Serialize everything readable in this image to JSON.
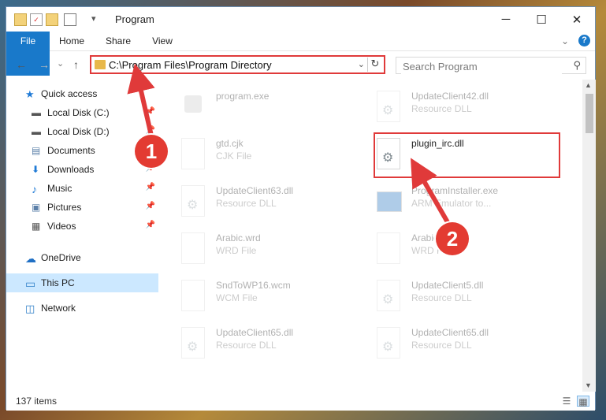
{
  "window": {
    "title": "Program",
    "minimize_glyph": "─",
    "maximize_glyph": "☐",
    "close_glyph": "✕"
  },
  "ribbon": {
    "tabs": [
      "File",
      "Home",
      "Share",
      "View"
    ],
    "expand_glyph": "⌄",
    "help_glyph": "?"
  },
  "address": {
    "back_glyph": "←",
    "forward_glyph": "→",
    "recent_glyph": "⌄",
    "up_glyph": "↑",
    "path": "C:\\Program Files\\Program Directory",
    "dropdown_glyph": "⌄",
    "refresh_glyph": "↻"
  },
  "search": {
    "placeholder": "Search Program",
    "icon": "search-icon",
    "glyph": "⚲"
  },
  "nav": {
    "pin_glyph": "📌",
    "items": [
      {
        "label": "Quick access",
        "icon": "star-icon",
        "glyph": "★",
        "color": "#1f7ad6"
      },
      {
        "label": "Local Disk (C:)",
        "icon": "disk-icon",
        "glyph": "▬",
        "color": "#555"
      },
      {
        "label": "Local Disk (D:)",
        "icon": "disk-icon",
        "glyph": "▬",
        "color": "#555"
      },
      {
        "label": "Documents",
        "icon": "document-icon",
        "glyph": "▤",
        "color": "#5a7fa8"
      },
      {
        "label": "Downloads",
        "icon": "download-icon",
        "glyph": "⬇",
        "color": "#1f7ad6"
      },
      {
        "label": "Music",
        "icon": "music-icon",
        "glyph": "♪",
        "color": "#1f7ad6"
      },
      {
        "label": "Pictures",
        "icon": "pictures-icon",
        "glyph": "▣",
        "color": "#5a7fa8"
      },
      {
        "label": "Videos",
        "icon": "videos-icon",
        "glyph": "▦",
        "color": "#555"
      },
      {
        "label": "OneDrive",
        "icon": "cloud-icon",
        "glyph": "☁",
        "color": "#1f6fc4"
      },
      {
        "label": "This PC",
        "icon": "computer-icon",
        "glyph": "▭",
        "color": "#2f7fc8"
      },
      {
        "label": "Network",
        "icon": "network-icon",
        "glyph": "◫",
        "color": "#2f7fc8"
      }
    ]
  },
  "files": [
    {
      "name": "program.exe",
      "type": ""
    },
    {
      "name": "UpdateClient42.dll",
      "type": "Resource DLL"
    },
    {
      "name": "gtd.cjk",
      "type": "CJK File"
    },
    {
      "name": "plugin_irc.dll",
      "type": ""
    },
    {
      "name": "UpdateClient63.dll",
      "type": "Resource DLL"
    },
    {
      "name": "ProgramInstaller.exe",
      "type": "ARM Emulator to..."
    },
    {
      "name": "Arabic.wrd",
      "type": "WRD File"
    },
    {
      "name": "Arabic.wrd",
      "type": "WRD File"
    },
    {
      "name": "SndToWP16.wcm",
      "type": "WCM File"
    },
    {
      "name": "UpdateClient5.dll",
      "type": "Resource DLL"
    },
    {
      "name": "UpdateClient65.dll",
      "type": "Resource DLL"
    },
    {
      "name": "UpdateClient65.dll",
      "type": "Resource DLL"
    }
  ],
  "status": {
    "count": "137 items",
    "details_view_glyph": "☰",
    "tiles_view_glyph": "▦"
  },
  "annotations": {
    "step1": "1",
    "step2": "2",
    "color": "#e03a3a"
  }
}
